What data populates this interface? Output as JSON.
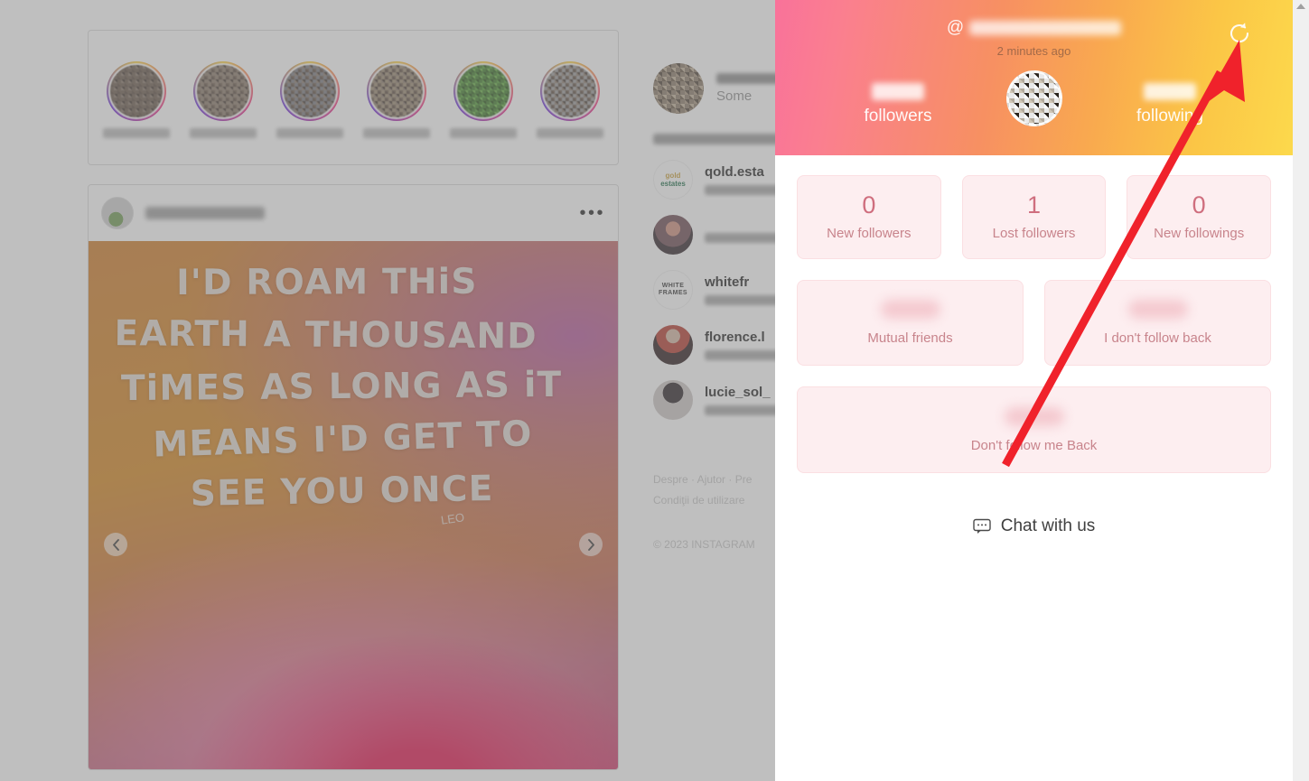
{
  "panel": {
    "header": {
      "at_symbol": "@",
      "handle_hidden": true,
      "updated_label": "2 minutes ago",
      "followers_label": "followers",
      "following_label": "following",
      "refresh_icon": "refresh-circular-arrow-icon",
      "gradient": [
        "#f9729a",
        "#f79062",
        "#fcd94c"
      ]
    },
    "stats_row1": [
      {
        "value": "0",
        "label": "New followers"
      },
      {
        "value": "1",
        "label": "Lost followers"
      },
      {
        "value": "0",
        "label": "New followings"
      }
    ],
    "stats_row2": [
      {
        "value": "",
        "label": "Mutual friends",
        "blurred": true
      },
      {
        "value": "",
        "label": "I don't follow back",
        "blurred": true
      }
    ],
    "stats_row3": [
      {
        "value": "",
        "label": "Don't follow me Back",
        "blurred": true
      }
    ],
    "chat": {
      "icon": "chat-bubble-icon",
      "label": "Chat with us"
    },
    "colors": {
      "card_bg": "#fdeef0",
      "card_border": "#fbdfe2",
      "num": "#cf6e7e",
      "caption": "#c8848c"
    }
  },
  "instagram": {
    "stories": [
      {
        "name_hidden": true
      },
      {
        "name_hidden": true
      },
      {
        "name_hidden": true
      },
      {
        "name_hidden": true
      },
      {
        "name_hidden": true
      },
      {
        "name_hidden": true
      }
    ],
    "post": {
      "username_hidden": true,
      "more_options": "•••",
      "prev_icon": "chevron-left-icon",
      "next_icon": "chevron-right-icon",
      "image_text": [
        "I'D ROAM THiS",
        "EARTH A THOUSAND",
        "TiMES AS LONG AS iT",
        "MEANS I'D GET TO",
        "SEE YOU ONCE"
      ],
      "image_signature": "LEO"
    },
    "account": {
      "name_hidden": true,
      "subtitle": "Some",
      "switch_label": ""
    },
    "suggestions": [
      {
        "username": "qold.esta",
        "avatar": "gold-estates-logo",
        "meta_hidden": true
      },
      {
        "username": "",
        "avatar": "photo-avatar",
        "meta_hidden": true
      },
      {
        "username": "whitefr",
        "avatar": "white-frames-logo",
        "meta_hidden": true
      },
      {
        "username": "florence.l",
        "avatar": "photo-avatar",
        "meta_hidden": true
      },
      {
        "username": "lucie_sol_",
        "avatar": "photo-avatar",
        "meta_hidden": true
      }
    ],
    "footer": {
      "line1": "Despre · Ajutor · Pre",
      "line2": "Condiţii de utilizare",
      "copyright": "© 2023 INSTAGRAM"
    }
  },
  "annotation": {
    "arrow_color": "#f0222b",
    "points_to": "refresh-button"
  }
}
